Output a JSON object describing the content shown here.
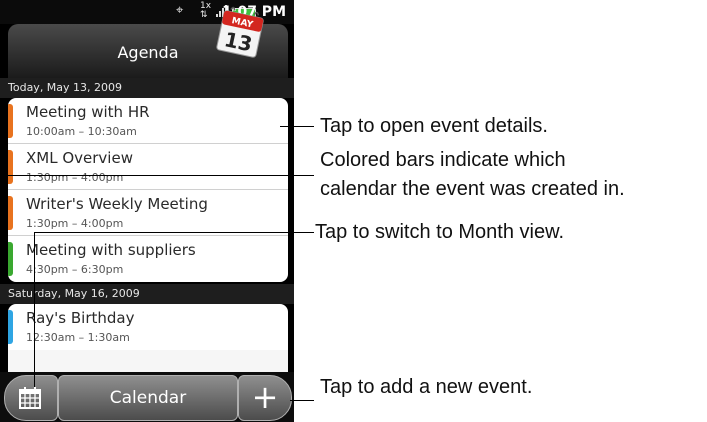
{
  "status_bar": {
    "time": "1:07 PM",
    "icons": [
      "gps-icon",
      "data-icon",
      "signal-icon",
      "battery-icon"
    ]
  },
  "header": {
    "title": "Agenda",
    "calendar_icon": {
      "month": "MAY",
      "day": "13"
    }
  },
  "days": [
    {
      "label": "Today, May 13, 2009",
      "events": [
        {
          "name": "Meeting with HR",
          "time": "10:00am – 10:30am",
          "color": "#e8731f"
        },
        {
          "name": "XML Overview",
          "time": "1:30pm – 4:00pm",
          "color": "#e8731f"
        },
        {
          "name": "Writer's Weekly Meeting",
          "time": "1:30pm – 4:00pm",
          "color": "#e8731f"
        },
        {
          "name": "Meeting with suppliers",
          "time": "4:30pm – 6:30pm",
          "color": "#3aa830"
        }
      ]
    },
    {
      "label": "Saturday, May 16, 2009",
      "events": [
        {
          "name": "Ray's Birthday",
          "time": "12:30am – 1:30am",
          "color": "#2fa5e3"
        }
      ]
    }
  ],
  "bottom_bar": {
    "calendar_label": "Calendar",
    "add_label": "+"
  },
  "callouts": {
    "open_details": "Tap to open event details.",
    "colored_bars_1": "Colored bars indicate which",
    "colored_bars_2": "calendar the event was created in.",
    "month_view": "Tap to switch to Month view.",
    "add_event": "Tap to add a new event."
  }
}
